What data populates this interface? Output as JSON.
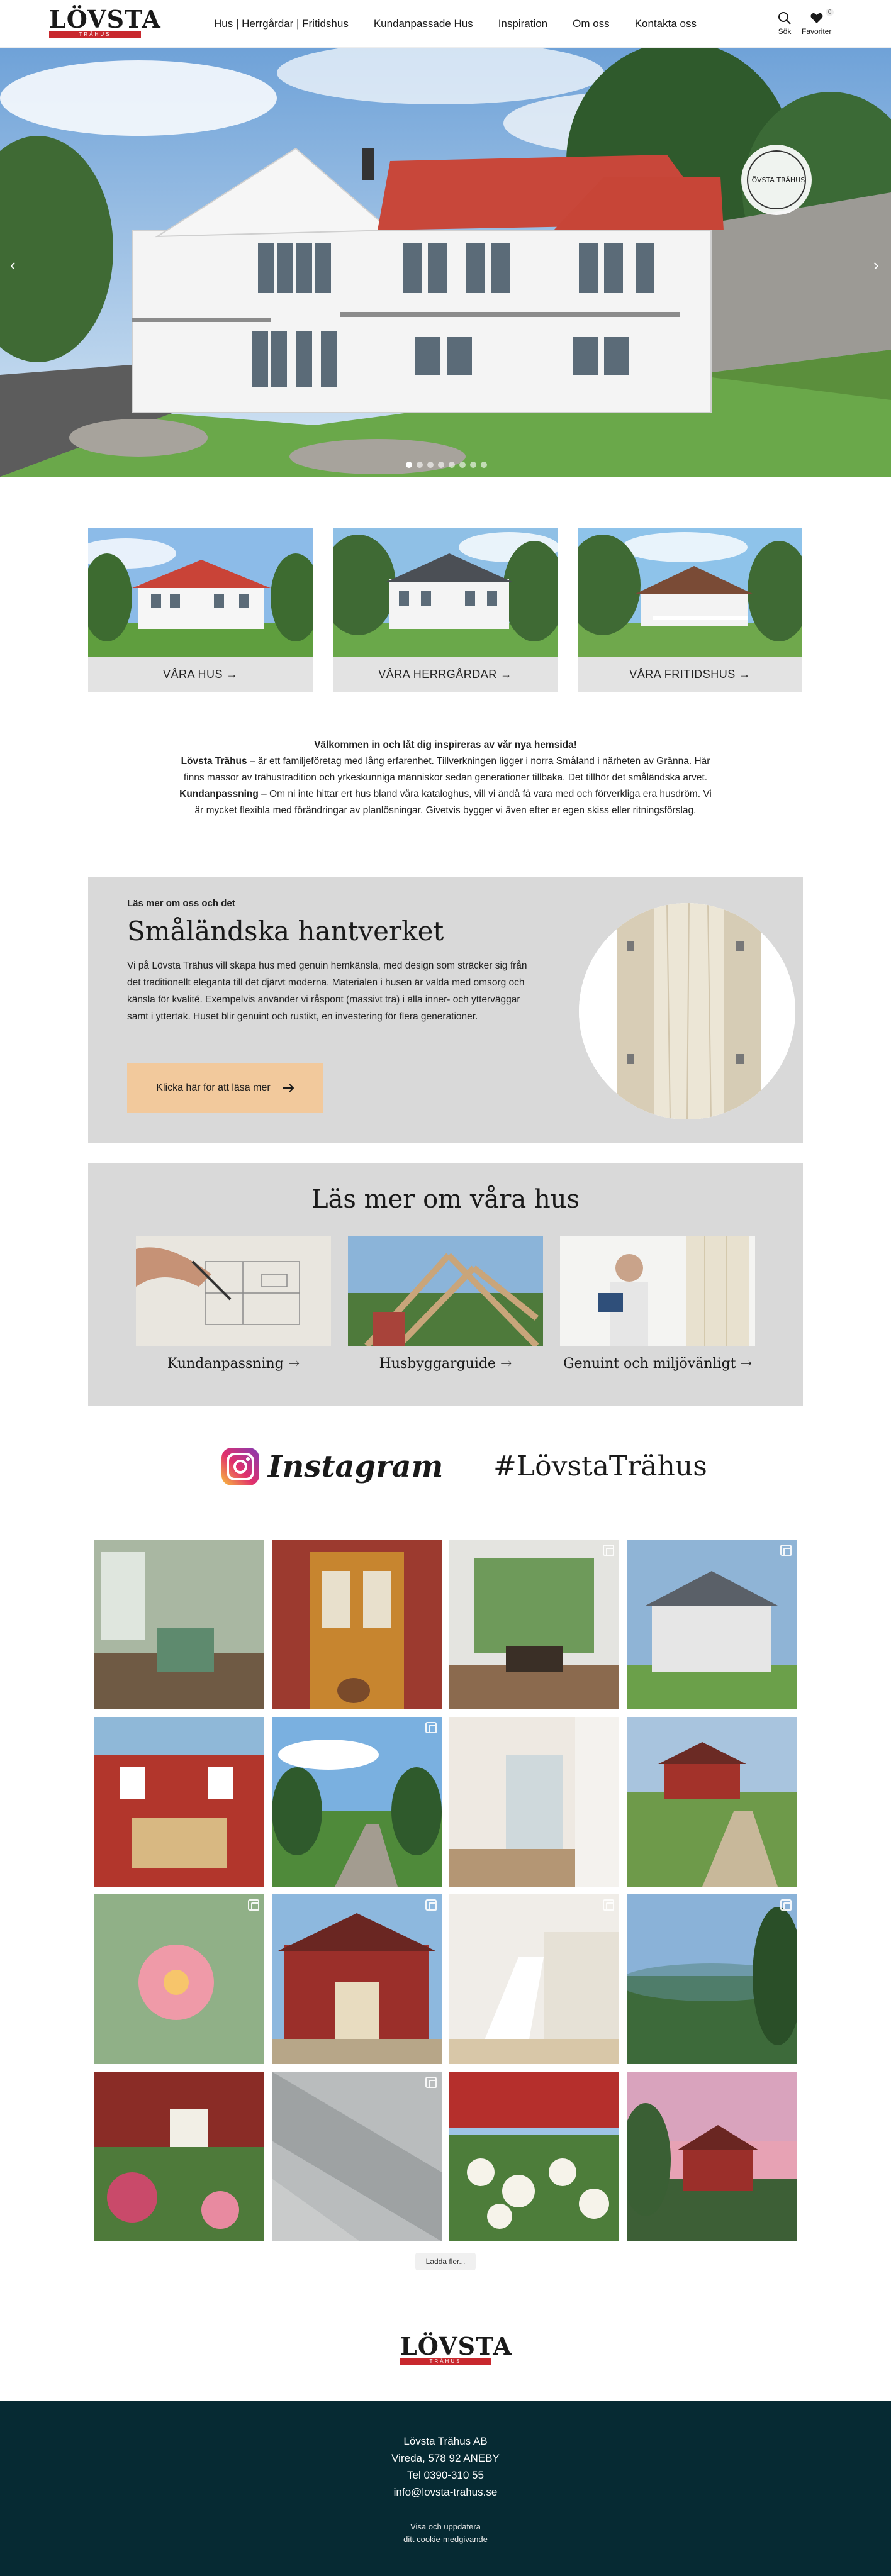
{
  "header": {
    "logo_text": "LÖVSTA",
    "logo_subtext": "TRÄHUS",
    "nav": [
      {
        "label": "Hus | Herrgårdar | Fritidshus"
      },
      {
        "label": "Kundanpassade Hus"
      },
      {
        "label": "Inspiration"
      },
      {
        "label": "Om oss"
      },
      {
        "label": "Kontakta oss"
      }
    ],
    "search_label": "Sök",
    "favorites_label": "Favoriter",
    "favorites_count": "0"
  },
  "hero": {
    "badge_text": "LÖVSTA TRÄHUS",
    "slide_count": 8,
    "active_slide": 1
  },
  "categories": [
    {
      "label": "VÅRA HUS →"
    },
    {
      "label": "VÅRA HERRGÅRDAR →"
    },
    {
      "label": "VÅRA FRITIDSHUS →"
    }
  ],
  "welcome": {
    "heading": "Välkommen in och låt dig inspireras av vår nya hemsida!",
    "p1_bold": "Lövsta Trähus",
    "p1_text": " – är ett familjeföretag med lång erfarenhet. Tillverkningen ligger i norra Småland i närheten av Gränna. Här finns massor av trähustradition och yrkeskunniga människor sedan generationer tillbaka. Det tillhör det småländska arvet.",
    "p2_bold": "Kundanpassning",
    "p2_text": " – Om ni inte hittar ert hus bland våra kataloghus, vill vi ändå få vara med och förverkliga era husdröm. Vi är mycket flexibla med förändringar av planlösningar. Givetvis bygger vi även efter er egen skiss eller ritningsförslag."
  },
  "craft": {
    "eyebrow": "Läs mer om oss och det",
    "title": "Småländska hantverket",
    "text": "Vi på Lövsta Trähus vill skapa hus med genuin hemkänsla, med design som sträcker sig från det traditionellt eleganta till det djärvt moderna. Materialen i husen är valda med omsorg och känsla för kvalité. Exempelvis använder vi råspont (massivt trä) i alla inner- och ytterväggar samt i yttertak. Huset blir genuint och rustikt, en investering för flera generationer.",
    "button_label": "Klicka här för att läsa mer"
  },
  "more": {
    "title": "Läs mer om våra hus",
    "items": [
      {
        "label": "Kundanpassning →"
      },
      {
        "label": "Husbyggarguide →"
      },
      {
        "label": "Genuint och miljövänligt →"
      }
    ]
  },
  "instagram": {
    "word": "Instagram",
    "hashtag": "#LövstaTrähus",
    "load_more": "Ladda fler..."
  },
  "footer": {
    "logo_text": "LÖVSTA",
    "logo_subtext": "TRÄHUS",
    "company": "Lövsta Trähus AB",
    "address": "Vireda, 578 92 ANEBY",
    "phone": "Tel 0390-310 55",
    "email": "info@lovsta-trahus.se",
    "cookie_line1": "Visa och uppdatera",
    "cookie_line2": "ditt cookie-medgivande"
  },
  "colors": {
    "brand_red": "#c8282e",
    "footer_bg": "#062a33",
    "card_gray": "#d9d9d9",
    "button_orange": "#f2c99c"
  }
}
